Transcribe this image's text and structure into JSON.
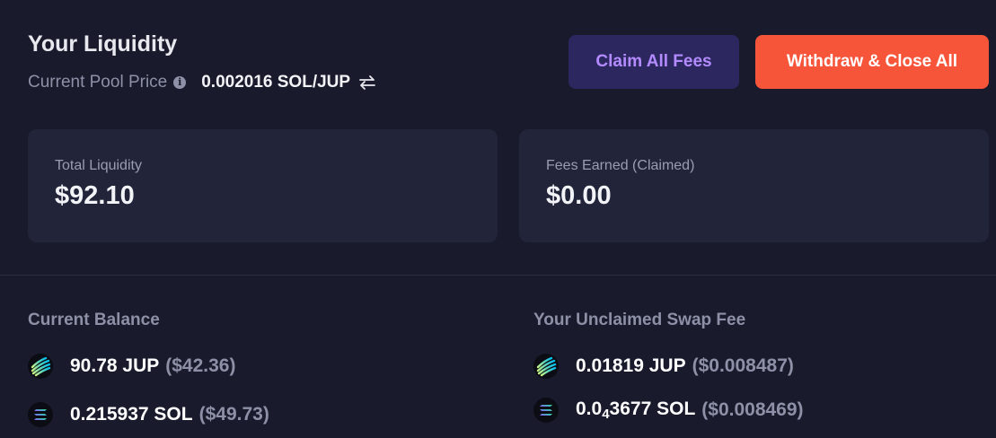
{
  "header": {
    "title": "Your Liquidity",
    "price_label": "Current Pool Price",
    "info_icon": "info-icon",
    "price_value": "0.002016 SOL/JUP",
    "swap_icon": "swap-arrows-icon"
  },
  "buttons": {
    "claim_label": "Claim All Fees",
    "withdraw_label": "Withdraw & Close All"
  },
  "cards": {
    "total_liquidity_label": "Total Liquidity",
    "total_liquidity_value": "$92.10",
    "fees_earned_label": "Fees Earned (Claimed)",
    "fees_earned_value": "$0.00"
  },
  "current_balance": {
    "title": "Current Balance",
    "items": [
      {
        "icon": "jup-token-icon",
        "amount": "90.78 JUP",
        "usd": "($42.36)"
      },
      {
        "icon": "sol-token-icon",
        "amount": "0.215937 SOL",
        "usd": "($49.73)"
      }
    ]
  },
  "unclaimed_fee": {
    "title": "Your Unclaimed Swap Fee",
    "items": [
      {
        "icon": "jup-token-icon",
        "amount": "0.01819 JUP",
        "usd": "($0.008487)"
      },
      {
        "icon": "sol-token-icon",
        "amount_prefix": "0.0",
        "amount_subscript": "4",
        "amount_suffix": "3677 SOL",
        "usd": "($0.008469)"
      }
    ]
  },
  "colors": {
    "background": "#191b2c",
    "card": "#22243a",
    "claim_button_bg": "#2d2760",
    "claim_button_text": "#b38bff",
    "withdraw_button_bg": "#f6553a",
    "muted_text": "#8d90a6"
  }
}
